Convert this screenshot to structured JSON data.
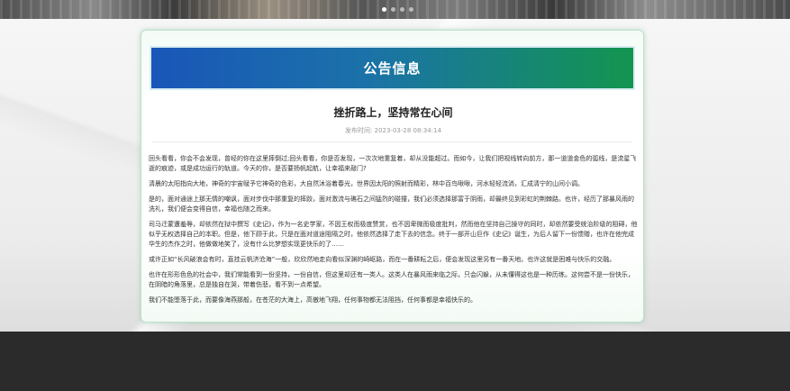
{
  "banner": {
    "slide_count": 4,
    "active_index": 0
  },
  "notice": {
    "header": "公告信息",
    "title": "挫折路上，坚持常在心间",
    "meta_label": "发布时间:",
    "date": "2023-03-28 08:34:14",
    "paragraphs": [
      "回头看看，你会不会发现，曾经的你在这里摔倒过;回头看看，你是否发现，一次次地重复着，却从没能超过。而如今，让我们把视线转向前方，那一道道金色的弧线，是流星飞逝的痕迹，或是成功运行的轨道。今天的你，是否要扬帆起航，让幸福来敲门?",
      "清晨的太阳指向大地，神奇的宇宙赋予它神奇的色彩，大自然沐浴着春光，世界因太阳的照射而精彩，林中百鸟啾啾，河水轻轻流淌，汇成清宁的山间小调。",
      "是的，面对通途上那无情的嘲讽，面对步伐中那重复的摔跤，面对激流与礁石之间猛烈的碰撞，我们必须选择那富于阴雨，却最终见到彩虹的荆棘路。也许，经历了那暴风雨的洗礼，我们便会变得自信，幸福也随之而来。",
      "司马迁蒙遭羞辱，却依然在狱中撰写《史记》，作为一名史学家，不因王权而极度赞赏，也不因卑微而极度批判，然而他在坚持自己操守的同时，却依然要受统治阶级的阻碍，他似乎无权选择自己的本职。但是，他下顾于此，只是在面对道途阻隔之时，他依然选择了走下去的信念。终于一部开山巨作《史记》诞生，为后人留下一份馈赠，也许在他完成华生的杰作之时，他做做地笑了，没有什么比梦想实现更快乐的了……",
      "或许正如“长风破浪会有时，直挂云帆济沧海”一般，欣欣然地走向看似深渊的崎岖路，而在一番耕耘之后，便会发现这里另有一番天地。也许这就是困难与快乐的交融。",
      "也许在形形色色的社会中，我们常能看到一份坚持，一份自信，但这里却还有一类人。这类人在暴风雨来临之际，只会闪躲，从未懂得这也是一种历练。这何尝不是一份快乐，在阴暗的角落里，总是独自在哭，带着伤悲，看不到一点希望。",
      "我们不能堕落于此，而要像海燕那般，在苍茫的大海上，高傲地飞翔，任何事物都无法阻挡，任何事都是幸福快乐的。"
    ]
  }
}
